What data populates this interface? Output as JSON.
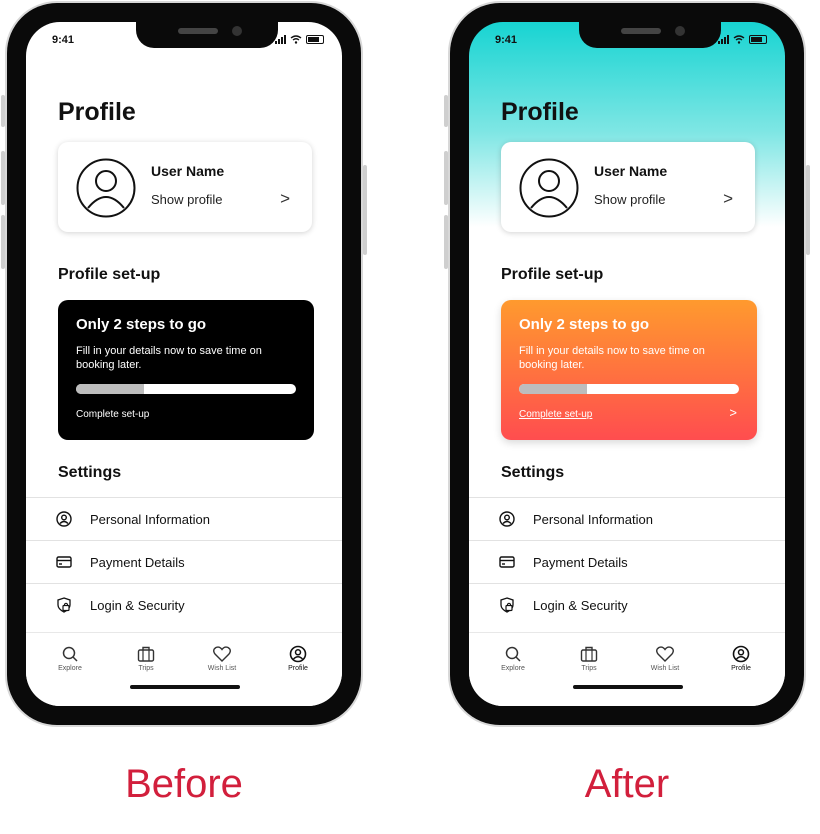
{
  "colors": {
    "caption_red": "#d21f3c",
    "after_header_gradient": "#17d4d2",
    "after_card_gradient_top": "#ff9a2e",
    "after_card_gradient_bottom": "#ff4d4f",
    "before_card": "#000000"
  },
  "panels": [
    {
      "variant": "before",
      "caption": "Before",
      "status": {
        "time": "9:41"
      },
      "title": "Profile",
      "user_card": {
        "name": "User Name",
        "action": "Show profile",
        "chevron": ">"
      },
      "setup_section_title": "Profile set-up",
      "setup_card": {
        "title": "Only 2 steps to go",
        "body": "Fill in your details now to save time on booking later.",
        "progress": 0.31,
        "link": "Complete set-up",
        "chevron": ""
      },
      "settings_title": "Settings",
      "settings_items": [
        {
          "label": "Personal Information",
          "icon": "user-circle-icon"
        },
        {
          "label": "Payment Details",
          "icon": "credit-card-icon"
        },
        {
          "label": "Login & Security",
          "icon": "shield-lock-icon"
        }
      ],
      "tabs": [
        {
          "label": "Explore",
          "icon": "search-icon",
          "active": false
        },
        {
          "label": "Trips",
          "icon": "briefcase-icon",
          "active": false
        },
        {
          "label": "Wish List",
          "icon": "heart-icon",
          "active": false
        },
        {
          "label": "Profile",
          "icon": "user-circle-icon",
          "active": true
        }
      ]
    },
    {
      "variant": "after",
      "caption": "After",
      "status": {
        "time": "9:41"
      },
      "title": "Profile",
      "user_card": {
        "name": "User Name",
        "action": "Show profile",
        "chevron": ">"
      },
      "setup_section_title": "Profile set-up",
      "setup_card": {
        "title": "Only 2 steps to go",
        "body": "Fill in your details now to save time on booking later.",
        "progress": 0.31,
        "link": "Complete set-up",
        "chevron": ">"
      },
      "settings_title": "Settings",
      "settings_items": [
        {
          "label": "Personal Information",
          "icon": "user-circle-icon"
        },
        {
          "label": "Payment Details",
          "icon": "credit-card-icon"
        },
        {
          "label": "Login & Security",
          "icon": "shield-lock-icon"
        }
      ],
      "tabs": [
        {
          "label": "Explore",
          "icon": "search-icon",
          "active": false
        },
        {
          "label": "Trips",
          "icon": "briefcase-icon",
          "active": false
        },
        {
          "label": "Wish List",
          "icon": "heart-icon",
          "active": false
        },
        {
          "label": "Profile",
          "icon": "user-circle-icon",
          "active": true
        }
      ]
    }
  ]
}
